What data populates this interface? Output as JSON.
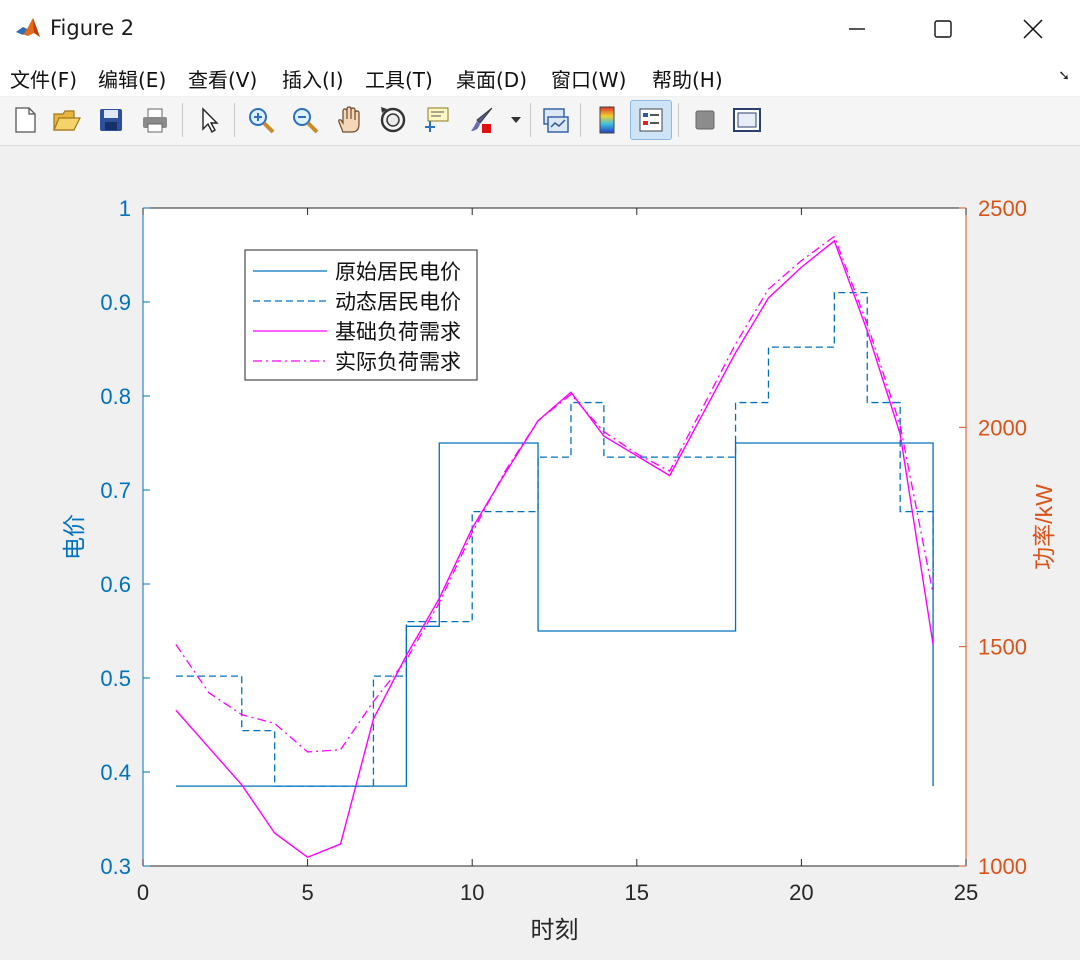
{
  "window": {
    "title": "Figure 2"
  },
  "menu": [
    "文件(F)",
    "编辑(E)",
    "查看(V)",
    "插入(I)",
    "工具(T)",
    "桌面(D)",
    "窗口(W)",
    "帮助(H)"
  ],
  "toolbar": {
    "icons": [
      "new-figure-icon",
      "open-file-icon",
      "save-icon",
      "print-icon",
      "pointer-icon",
      "zoom-in-icon",
      "zoom-out-icon",
      "pan-icon",
      "rotate-3d-icon",
      "data-cursor-icon",
      "brush-icon",
      "brush-dropdown-icon",
      "link-plot-icon",
      "colorbar-icon",
      "legend-icon",
      "hide-plot-tools-icon",
      "show-plot-tools-icon"
    ]
  },
  "colors": {
    "left_axis": "#0072BD",
    "right_axis": "#D95319",
    "load": "#FF00FF"
  },
  "chart_data": {
    "type": "line",
    "xlabel": "时刻",
    "ylabel_left": "电价",
    "ylabel_right": "功率/kW",
    "xlim": [
      0,
      25
    ],
    "ylim_left": [
      0.3,
      1.0
    ],
    "ylim_right": [
      1000,
      2500
    ],
    "xticks": [
      0,
      5,
      10,
      15,
      20,
      25
    ],
    "yticks_left": [
      0.3,
      0.4,
      0.5,
      0.6,
      0.7,
      0.8,
      0.9,
      1.0
    ],
    "yticks_left_labels": [
      "0.3",
      "0.4",
      "0.5",
      "0.6",
      "0.7",
      "0.8",
      "0.9",
      "1"
    ],
    "yticks_right": [
      1000,
      1500,
      2000,
      2500
    ],
    "legend_position": "top-left",
    "series": [
      {
        "name": "原始居民电价",
        "axis": "left",
        "style": "stairs-solid",
        "x": [
          1,
          2,
          3,
          4,
          5,
          6,
          7,
          8,
          9,
          10,
          11,
          12,
          13,
          14,
          15,
          16,
          17,
          18,
          19,
          20,
          21,
          22,
          23,
          24
        ],
        "values": [
          0.385,
          0.385,
          0.385,
          0.385,
          0.385,
          0.385,
          0.385,
          0.555,
          0.75,
          0.75,
          0.75,
          0.55,
          0.55,
          0.55,
          0.55,
          0.55,
          0.55,
          0.75,
          0.75,
          0.75,
          0.75,
          0.75,
          0.75,
          0.385
        ]
      },
      {
        "name": "动态居民电价",
        "axis": "left",
        "style": "stairs-dashed",
        "x": [
          1,
          2,
          3,
          4,
          5,
          6,
          7,
          8,
          9,
          10,
          11,
          12,
          13,
          14,
          15,
          16,
          17,
          18,
          19,
          20,
          21,
          22,
          23,
          24
        ],
        "values": [
          0.502,
          0.502,
          0.444,
          0.385,
          0.385,
          0.385,
          0.502,
          0.56,
          0.56,
          0.677,
          0.677,
          0.735,
          0.793,
          0.735,
          0.735,
          0.735,
          0.735,
          0.793,
          0.852,
          0.852,
          0.91,
          0.793,
          0.677,
          0.592
        ]
      },
      {
        "name": "基础负荷需求",
        "axis": "right",
        "style": "solid",
        "x": [
          1,
          2,
          3,
          4,
          5,
          6,
          7,
          8,
          9,
          10,
          11,
          12,
          13,
          14,
          15,
          16,
          17,
          18,
          19,
          20,
          21,
          22,
          23,
          24
        ],
        "values": [
          1355,
          1270,
          1185,
          1075,
          1020,
          1050,
          1335,
          1480,
          1610,
          1770,
          1895,
          2015,
          2080,
          1980,
          1935,
          1890,
          2030,
          2170,
          2295,
          2365,
          2425,
          2220,
          1985,
          1505
        ]
      },
      {
        "name": "实际负荷需求",
        "axis": "right",
        "style": "dashdot",
        "x": [
          1,
          2,
          3,
          4,
          5,
          6,
          7,
          8,
          9,
          10,
          11,
          12,
          13,
          14,
          15,
          16,
          17,
          18,
          19,
          20,
          21,
          22,
          23,
          24
        ],
        "values": [
          1505,
          1395,
          1345,
          1325,
          1260,
          1265,
          1375,
          1470,
          1600,
          1760,
          1900,
          2015,
          2075,
          1990,
          1940,
          1900,
          2045,
          2190,
          2315,
          2380,
          2435,
          2235,
          2005,
          1620
        ]
      }
    ]
  }
}
